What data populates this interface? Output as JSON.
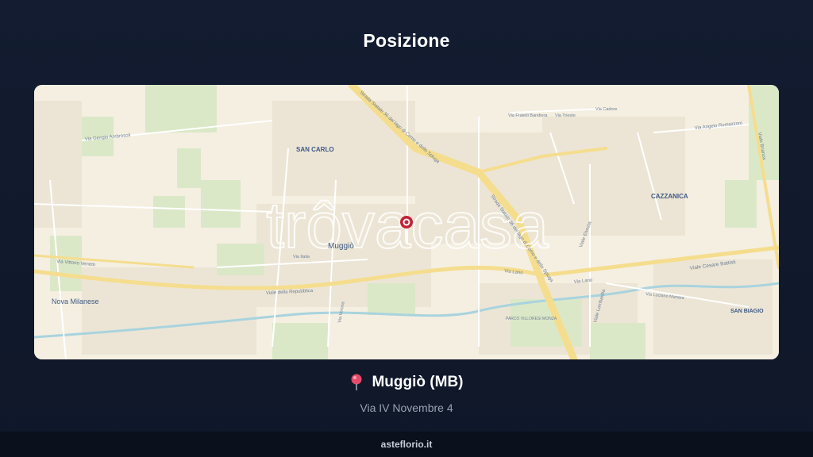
{
  "page": {
    "title": "Posizione"
  },
  "map": {
    "watermark": "trôvacasa",
    "areas": {
      "san_carlo": "SAN CARLO",
      "muggio": "Muggiò",
      "cazzanica": "CAZZANICA",
      "nova_milanese": "Nova Milanese",
      "san_biagio": "SAN BIAGIO"
    },
    "streets": {
      "giorgio_ambrosoli": "Via Giorgio Ambrosoli",
      "strada_statale_top": "Strada Statale 36 del lago di Como e dello Spluga",
      "strada_statale_right": "Strada Statale 36 del lago di Como e dello Spluga",
      "fratelli_bandiera": "Via Fratelli Bandiera",
      "trieste": "Via Trieste",
      "cadore": "Via Cadore",
      "angelo_rumazzoni": "Via Angelo Rumazzoni",
      "brianza": "Viale Brianza",
      "vittorio_veneto": "Via Vittorio Veneto",
      "repubblica": "Viale della Repubblica",
      "lario_center": "Via Lario",
      "lario_right": "Via Lario",
      "cesare_battisti": "Viale Cesare Battisti",
      "elvezia": "Viale Elvezia",
      "lombardia": "Viale Lombardia",
      "luciano_manara": "Via Luciano Manara",
      "italia": "Via Italia",
      "verona": "Via Verona",
      "parco_villoresi": "PARCO VILLORESI MONZA"
    },
    "marker": {
      "name": "Muggiò (MB)"
    }
  },
  "location": {
    "name": "Muggiò (MB)",
    "address": "Via IV Novembre 4"
  },
  "footer": {
    "brand": "asteflorio.it"
  },
  "colors": {
    "background": "#131c30",
    "map_land": "#f4efe1",
    "road_major": "#f5dd8e",
    "park": "#dbe8c8",
    "water": "#a9d3de",
    "marker": "#c62036"
  }
}
